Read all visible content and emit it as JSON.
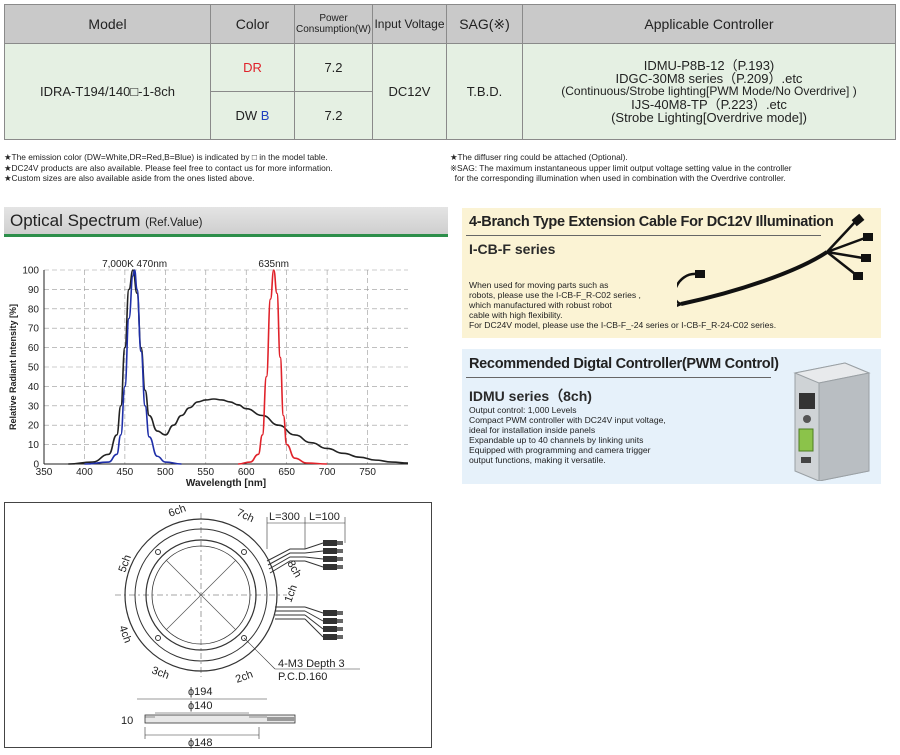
{
  "table": {
    "headers": {
      "model": "Model",
      "color": "Color",
      "power_line1": "Power",
      "power_line2": "Consumption(W)",
      "input_voltage": "Input Voltage",
      "sag": "SAG(※)",
      "controller": "Applicable Controller"
    },
    "model": "IDRA-T194/140□-1-8ch",
    "rows": [
      {
        "color_prefix": "",
        "color_code": "DR",
        "power": "7.2"
      },
      {
        "color_prefix": "DW ",
        "color_code": "B",
        "power": "7.2"
      }
    ],
    "input_voltage": "DC12V",
    "sag": "T.B.D.",
    "controllers": [
      "IDMU-P8B-12（P.193)",
      "IDGC-30M8 series（P.209）.etc",
      "(Continuous/Strobe lighting[PWM Mode/No Overdrive] )",
      "IJS-40M8-TP（P.223）.etc",
      "(Strobe Lighting[Overdrive mode])"
    ]
  },
  "notes_left": [
    "★The emission color (DW=White,DR=Red,B=Blue) is indicated by □ in the model table.",
    "★DC24V products are also available. Please feel free to contact us for more information.",
    "★Custom sizes are also available aside from the ones listed above."
  ],
  "notes_right": [
    "★The diffuser ring could be attached (Optional).",
    "※SAG: The maximum instantaneous upper limit output voltage setting value in the controller",
    "  for the corresponding illumination when used in combination with the Overdrive controller."
  ],
  "section": {
    "title": "Optical Spectrum",
    "subtitle": "(Ref.Value)"
  },
  "chart_data": {
    "type": "line",
    "xlabel": "Wavelength [nm]",
    "ylabel": "Relative Radiant Intensity [%]",
    "xlim": [
      350,
      800
    ],
    "ylim": [
      0,
      100
    ],
    "x_ticks": [
      350,
      400,
      450,
      500,
      550,
      600,
      650,
      700,
      750
    ],
    "y_ticks": [
      0,
      10,
      20,
      30,
      40,
      50,
      60,
      70,
      80,
      90,
      100
    ],
    "grid": true,
    "annotations": [
      {
        "text": "7,000K 470nm",
        "x": 462
      },
      {
        "text": "635nm",
        "x": 634
      }
    ],
    "series": [
      {
        "color": "#222222",
        "x": [
          380,
          410,
          430,
          440,
          445,
          450,
          455,
          460,
          465,
          470,
          475,
          480,
          490,
          500,
          510,
          520,
          530,
          540,
          550,
          560,
          570,
          580,
          590,
          600,
          620,
          640,
          660,
          680,
          700,
          720,
          740,
          760,
          780,
          800
        ],
        "y": [
          0,
          1,
          5,
          15,
          30,
          60,
          90,
          100,
          88,
          60,
          38,
          25,
          17,
          15,
          20,
          25,
          29,
          32,
          33,
          33.5,
          33,
          32,
          30.5,
          28.5,
          25,
          20,
          15,
          11,
          8,
          5.5,
          3.5,
          2,
          1,
          0.5
        ]
      },
      {
        "color": "#1f2fa8",
        "x": [
          400,
          430,
          440,
          445,
          450,
          455,
          460,
          462,
          465,
          470,
          475,
          480,
          490,
          500,
          520
        ],
        "y": [
          0,
          1,
          5,
          15,
          40,
          75,
          97,
          100,
          90,
          58,
          30,
          14,
          4,
          1,
          0
        ]
      },
      {
        "color": "#e0222a",
        "x": [
          590,
          605,
          615,
          620,
          625,
          630,
          634,
          638,
          642,
          646,
          650,
          660,
          675,
          700
        ],
        "y": [
          0,
          1,
          5,
          15,
          45,
          85,
          100,
          88,
          55,
          25,
          10,
          3,
          0.5,
          0
        ]
      }
    ]
  },
  "drawing": {
    "labels": {
      "ch6": "6ch",
      "ch7": "7ch",
      "ch8": "8ch",
      "ch1": "1ch",
      "ch2": "2ch",
      "ch3": "3ch",
      "ch4": "4ch",
      "ch5": "5ch",
      "l300": "L=300",
      "l100": "L=100",
      "hole": "4-M3 Depth 3",
      "pcd": "P.C.D.160",
      "d194": "ϕ194",
      "d140": "ϕ140",
      "d148": "ϕ148",
      "t10": "10"
    }
  },
  "cable_panel": {
    "title": "4-Branch Type Extension Cable For DC12V Illumination",
    "subtitle": "I-CB-F series",
    "lines": [
      "When used for moving parts such as",
      "robots, please use the I-CB-F_R-C02 series ,",
      "which manufactured with robust robot",
      "cable with high flexibility.",
      "For DC24V model, please use the I-CB-F_-24 series or I-CB-F_R-24-C02 series."
    ]
  },
  "controller_panel": {
    "title": "Recommended Digtal Controller(PWM Control)",
    "subtitle": "IDMU series（8ch)",
    "lines": [
      "Output control: 1,000 Levels",
      "Compact PWM controller with DC24V input voltage,",
      "ideal for installation inside panels",
      "Expandable up to 40 channels by linking units",
      "Equipped with programming and camera trigger",
      "output functions, making it versatile."
    ]
  }
}
